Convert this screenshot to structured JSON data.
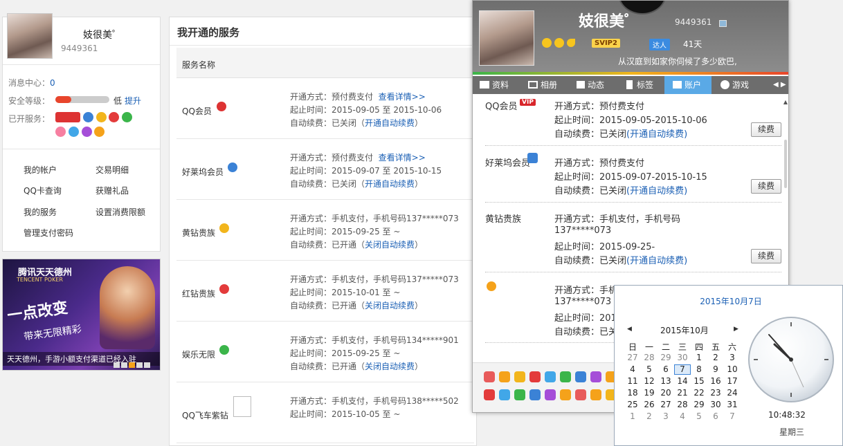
{
  "profile": {
    "nickname": "妓很美゜",
    "qq": "9449361"
  },
  "left": {
    "msg_label": "消息中心：",
    "msg_count": "0",
    "sec_label": "安全等级：",
    "sec_level": "低",
    "sec_fill": 0.3,
    "sec_link": "提升",
    "svc_label": "已开服务：",
    "nav": [
      "我的帐户",
      "交易明细",
      "QQ卡查询",
      "获赠礼品",
      "我的服务",
      "设置消费限额",
      "管理支付密码"
    ]
  },
  "banner": {
    "logo": "腾讯天天德州",
    "logo_en": "TENCENT POKER",
    "slogan": "一点改变",
    "slogan2": "带来无限精彩",
    "caption": "天天德州，手游小额支付渠道已经入驻"
  },
  "main": {
    "title": "我开通的服务",
    "col": "服务名称",
    "services": [
      {
        "name": "QQ会员",
        "l1": "开通方式：预付费支付",
        "link": "查看详情>>",
        "l2": "起止时间：2015-09-05 至 2015-10-06",
        "l3a": "自动续费：已关闭（",
        "l3link": "开通自动续费",
        "l3b": "）"
      },
      {
        "name": "好莱坞会员",
        "l1": "开通方式：预付费支付",
        "link": "查看详情>>",
        "l2": "起止时间：2015-09-07 至 2015-10-15",
        "l3a": "自动续费：已关闭（",
        "l3link": "开通自动续费",
        "l3b": "）"
      },
      {
        "name": "黄钻贵族",
        "l1": "开通方式：手机支付，手机号码137*****073",
        "link": "",
        "l2": "起止时间：2015-09-25 至 ~",
        "l3a": "自动续费：已开通（",
        "l3link": "关闭自动续费",
        "l3b": "）"
      },
      {
        "name": "红钻贵族",
        "l1": "开通方式：手机支付，手机号码137*****073",
        "link": "",
        "l2": "起止时间：2015-10-01 至 ~",
        "l3a": "自动续费：已开通（",
        "l3link": "关闭自动续费",
        "l3b": "）"
      },
      {
        "name": "娱乐无限",
        "l1": "开通方式：手机支付，手机号码134*****901",
        "link": "",
        "l2": "起止时间：2015-09-25 至 ~",
        "l3a": "自动续费：已开通（",
        "l3link": "关闭自动续费",
        "l3b": "）"
      },
      {
        "name": "QQ飞车紫钻",
        "l1": "开通方式：手机支付，手机号码138*****502",
        "link": "",
        "l2": "起止时间：2015-10-05 至 ~",
        "l3a": "",
        "l3link": "",
        "l3b": ""
      }
    ]
  },
  "popup": {
    "nickname": "妓很美゜",
    "qq": "9449361",
    "vip": "SVIP2",
    "daren": "达人",
    "days": "41天",
    "signature": "从汉庭到如家你伺候了多少欧巴,",
    "tabs": [
      "资料",
      "相册",
      "动态",
      "标签",
      "账户",
      "游戏"
    ],
    "rows": [
      {
        "name": "QQ会员",
        "badge": "VIP",
        "l1": "开通方式：预付费支付",
        "l2": "起止时间：2015-09-05-2015-10-06",
        "l3": "自动续费：已关闭",
        "l3link": "(开通自动续费)",
        "btn": "续费"
      },
      {
        "name": "好莱坞会员",
        "l1": "开通方式：预付费支付",
        "l2": "起止时间：2015-09-07-2015-10-15",
        "l3": "自动续费：已关闭",
        "l3link": "(开通自动续费)",
        "btn": "续费"
      },
      {
        "name": "黄钻贵族",
        "l1": "开通方式：手机支付，手机号码",
        "l1b": "137*****073",
        "l2": "起止时间：2015-09-25-",
        "l3": "自动续费：已关闭",
        "l3link": "(开通自动续费)",
        "btn": "续费"
      },
      {
        "name": "",
        "l1": "开通方式：手机支付，手机号码",
        "l1b": "137*****073",
        "l2": "起止时间：201",
        "l3": "自动续费：已关"
      }
    ]
  },
  "calendar": {
    "title": "2015年10月7日",
    "month": "2015年10月",
    "weekdays": [
      "日",
      "一",
      "二",
      "三",
      "四",
      "五",
      "六"
    ],
    "days": [
      [
        "27",
        "28",
        "29",
        "30",
        "1",
        "2",
        "3"
      ],
      [
        "4",
        "5",
        "6",
        "7",
        "8",
        "9",
        "10"
      ],
      [
        "11",
        "12",
        "13",
        "14",
        "15",
        "16",
        "17"
      ],
      [
        "18",
        "19",
        "20",
        "21",
        "22",
        "23",
        "24"
      ],
      [
        "25",
        "26",
        "27",
        "28",
        "29",
        "30",
        "31"
      ],
      [
        "1",
        "2",
        "3",
        "4",
        "5",
        "6",
        "7"
      ]
    ],
    "time": "10:48:32",
    "weekday": "星期三"
  },
  "colors": {
    "link": "#1a5fb4",
    "tab_active": "#5aa9e6",
    "security_bar": "#e8452c"
  }
}
